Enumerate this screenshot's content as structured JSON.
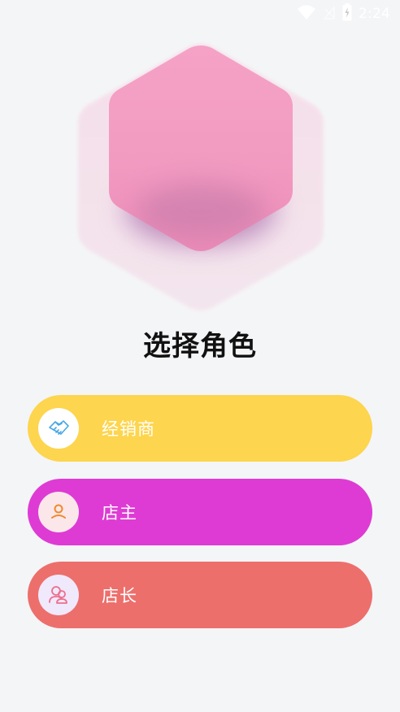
{
  "status_bar": {
    "time": "2:24",
    "icons": [
      "wifi-icon",
      "signal-off-icon",
      "battery-charging-icon"
    ]
  },
  "page": {
    "title": "选择角色"
  },
  "roles": [
    {
      "label": "经销商",
      "icon": "handshake-icon",
      "color": "#fdd54e",
      "icon_bg": "#ffffff"
    },
    {
      "label": "店主",
      "icon": "user-icon",
      "color": "#de3bd4",
      "icon_bg": "#fbe7ea"
    },
    {
      "label": "店长",
      "icon": "users-icon",
      "color": "#ec6f6c",
      "icon_bg": "#f0e8fb"
    }
  ]
}
